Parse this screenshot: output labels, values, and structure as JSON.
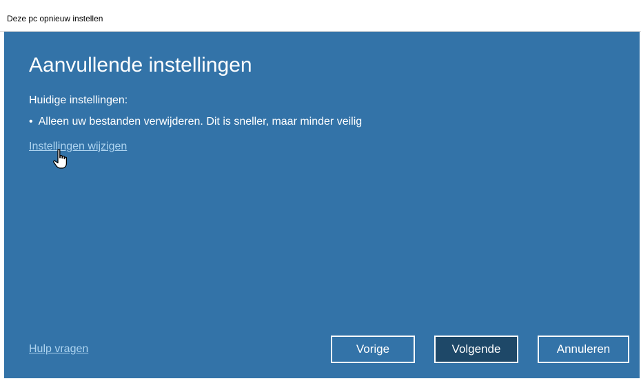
{
  "window": {
    "title": "Deze pc opnieuw instellen"
  },
  "main": {
    "heading": "Aanvullende instellingen",
    "current_label": "Huidige instellingen:",
    "current_bullet": "•",
    "current_setting": "Alleen uw bestanden verwijderen. Dit is sneller, maar minder veilig",
    "change_link": "Instellingen wijzigen"
  },
  "footer": {
    "help_link": "Hulp vragen",
    "prev_button": "Vorige",
    "next_button": "Volgende",
    "cancel_button": "Annuleren"
  },
  "icons": {
    "cursor": "hand-pointer-cursor-icon"
  },
  "colors": {
    "panel": "#3373a8",
    "link": "#aed4f0",
    "next_button_bg": "#1e4868"
  }
}
